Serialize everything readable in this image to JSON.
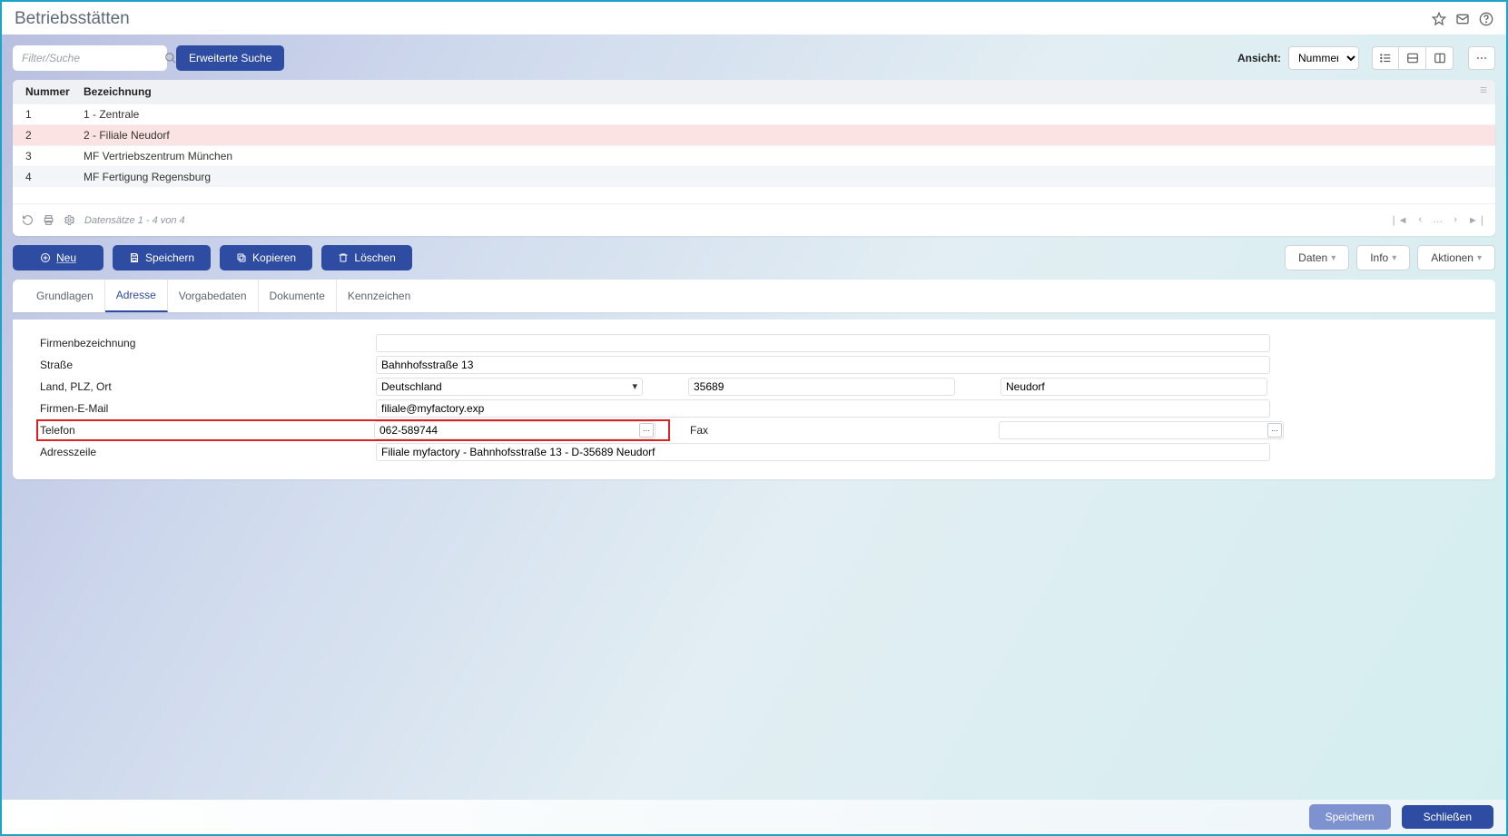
{
  "title": "Betriebsstätten",
  "search": {
    "placeholder": "Filter/Suche"
  },
  "extended_search": "Erweiterte Suche",
  "view_label": "Ansicht:",
  "view_value": "Nummer",
  "grid": {
    "cols": {
      "num": "Nummer",
      "bez": "Bezeichnung"
    },
    "rows": [
      {
        "num": "1",
        "bez": "1 - Zentrale"
      },
      {
        "num": "2",
        "bez": "2 - Filiale Neudorf"
      },
      {
        "num": "3",
        "bez": "MF Vertriebszentrum München"
      },
      {
        "num": "4",
        "bez": "MF Fertigung Regensburg"
      }
    ],
    "count_text": "Datensätze 1 - 4 von 4"
  },
  "actions": {
    "new": "Neu",
    "save": "Speichern",
    "copy": "Kopieren",
    "delete": "Löschen",
    "data": "Daten",
    "info": "Info",
    "actions": "Aktionen"
  },
  "tabs": [
    "Grundlagen",
    "Adresse",
    "Vorgabedaten",
    "Dokumente",
    "Kennzeichen"
  ],
  "form": {
    "labels": {
      "company": "Firmenbezeichnung",
      "street": "Straße",
      "country_zip_city": "Land, PLZ, Ort",
      "email": "Firmen-E-Mail",
      "phone": "Telefon",
      "fax": "Fax",
      "addressline": "Adresszeile"
    },
    "values": {
      "company": "",
      "street": "Bahnhofsstraße 13",
      "country": "Deutschland",
      "zip": "35689",
      "city": "Neudorf",
      "email": "filiale@myfactory.exp",
      "phone": "062-589744",
      "fax": "",
      "addressline": "Filiale myfactory - Bahnhofsstraße 13 - D-35689 Neudorf"
    }
  },
  "footer": {
    "save": "Speichern",
    "close": "Schließen"
  }
}
